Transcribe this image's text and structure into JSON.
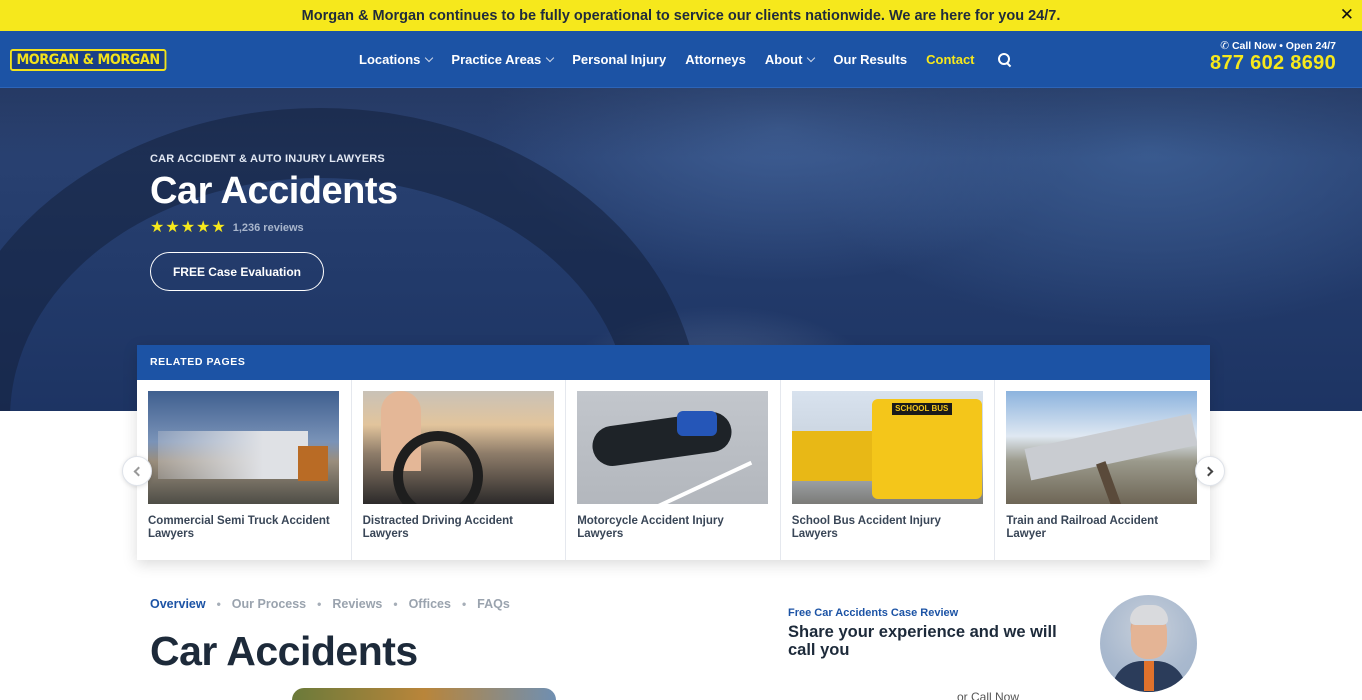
{
  "announcement": {
    "text": "Morgan & Morgan continues to be fully operational to service our clients nationwide. We are here for you 24/7.",
    "close_icon": "close-icon"
  },
  "header": {
    "logo_text": "MORGAN & MORGAN",
    "menu": [
      {
        "label": "Locations",
        "has_dropdown": true
      },
      {
        "label": "Practice Areas",
        "has_dropdown": true
      },
      {
        "label": "Personal Injury",
        "has_dropdown": false
      },
      {
        "label": "Attorneys",
        "has_dropdown": false
      },
      {
        "label": "About",
        "has_dropdown": true
      },
      {
        "label": "Our Results",
        "has_dropdown": false
      },
      {
        "label": "Contact",
        "has_dropdown": false
      }
    ],
    "call_line": "Call Now • Open 24/7",
    "phone": "877 602 8690",
    "accent_color": "#f6e81c",
    "nav_color": "#1c53a5"
  },
  "hero": {
    "eyebrow": "CAR ACCIDENT & AUTO INJURY LAWYERS",
    "title": "Car Accidents",
    "rating_stars": 5,
    "reviews": "1,236 reviews",
    "cta": "FREE Case Evaluation"
  },
  "related": {
    "heading": "RELATED PAGES",
    "cards": [
      {
        "title": "Commercial Semi Truck Accident Lawyers"
      },
      {
        "title": "Distracted Driving Accident Lawyers"
      },
      {
        "title": "Motorcycle Accident Injury Lawyers"
      },
      {
        "title": "School Bus Accident Injury Lawyers",
        "image_text": "SCHOOL BUS"
      },
      {
        "title": "Train and Railroad Accident Lawyer"
      }
    ]
  },
  "subnav": {
    "tabs": [
      "Overview",
      "Our Process",
      "Reviews",
      "Offices",
      "FAQs"
    ],
    "active": "Overview"
  },
  "main": {
    "title": "Car Accidents"
  },
  "review_box": {
    "label": "Free Car Accidents Case Review",
    "heading": "Share your experience and we will call you",
    "or_call": "or Call Now"
  }
}
